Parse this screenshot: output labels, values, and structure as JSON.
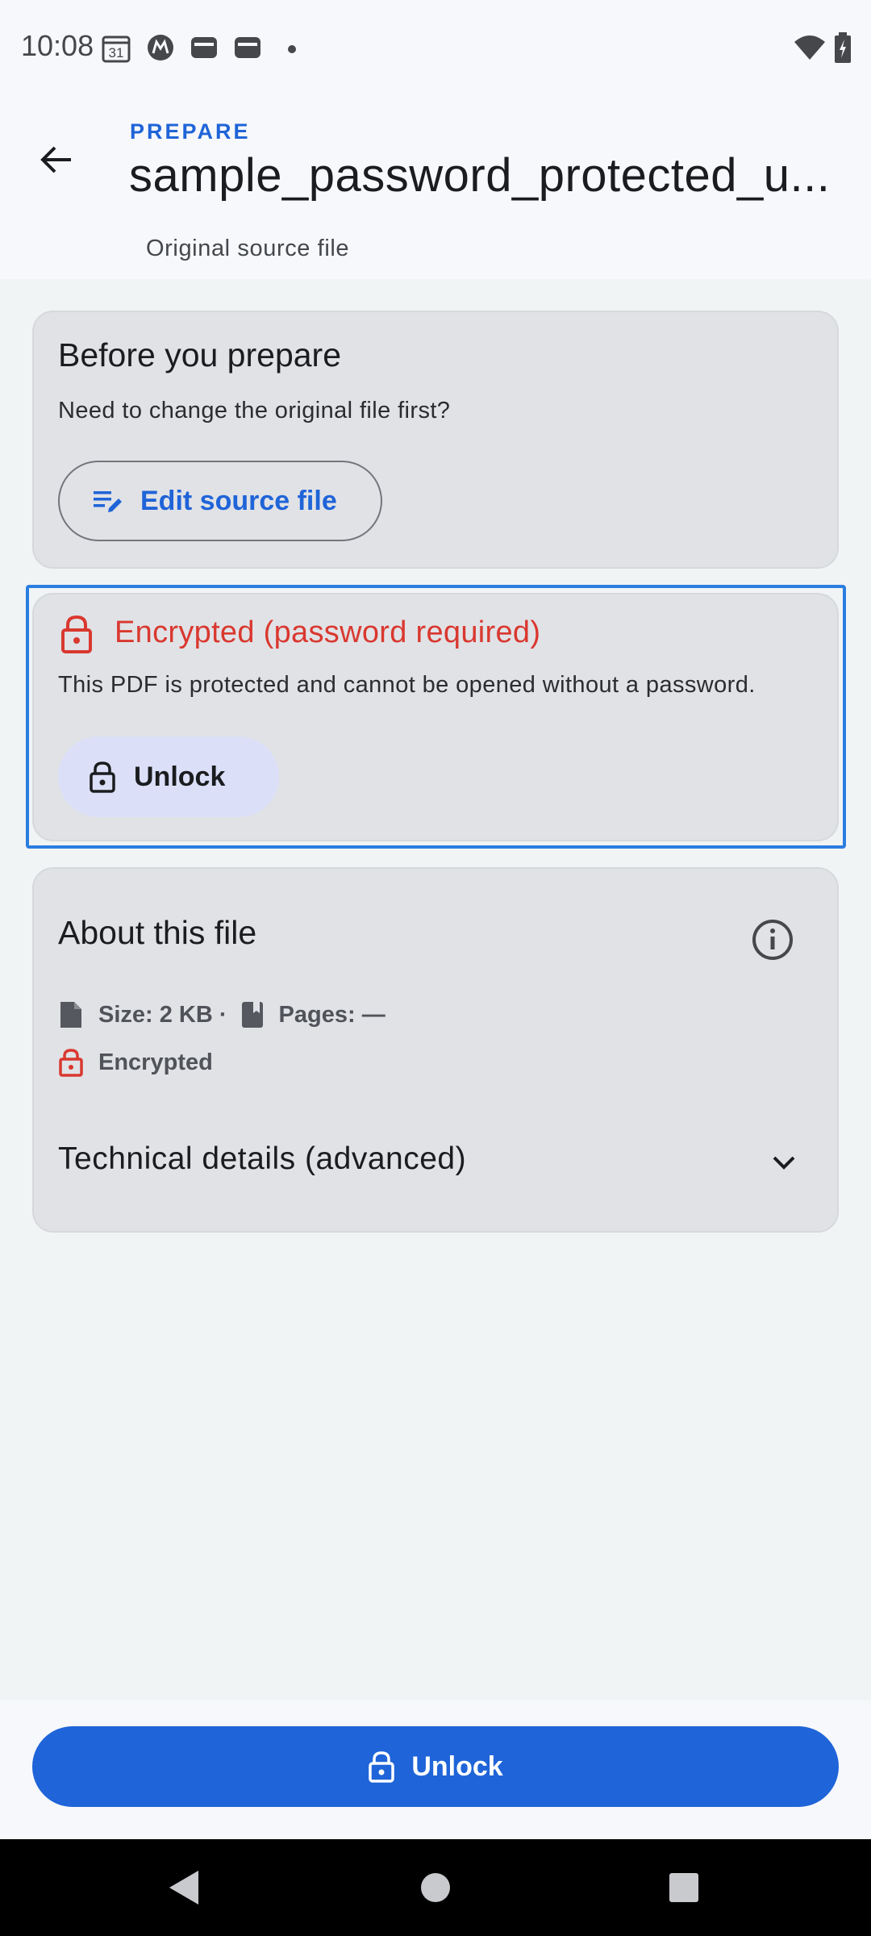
{
  "status_bar": {
    "time": "10:08",
    "calendar_day": "31",
    "icons": [
      "calendar-icon",
      "motorola-icon",
      "wallet-icon",
      "wallet-icon",
      "dot-icon",
      "wifi-icon",
      "battery-icon"
    ]
  },
  "header": {
    "eyebrow": "PREPARE",
    "title": "sample_password_protected_u...",
    "subtitle": "Original source file"
  },
  "prepare_card": {
    "heading": "Before you prepare",
    "body": "Need to change the original file first?",
    "button_label": "Edit source file"
  },
  "encryption_card": {
    "heading": "Encrypted (password required)",
    "body": "This PDF is protected and cannot be opened without a password.",
    "button_label": "Unlock"
  },
  "about_card": {
    "heading": "About this file",
    "size": "Size: 2 KB ·",
    "pages": "Pages: —",
    "encryption": "Encrypted",
    "details_label": "Technical details (advanced)"
  },
  "bottom_action": {
    "label": "Unlock"
  },
  "colors": {
    "primary": "#1f64d8",
    "error": "#d9382f",
    "card": "#e1e2e6",
    "background": "#f1f4f5"
  }
}
